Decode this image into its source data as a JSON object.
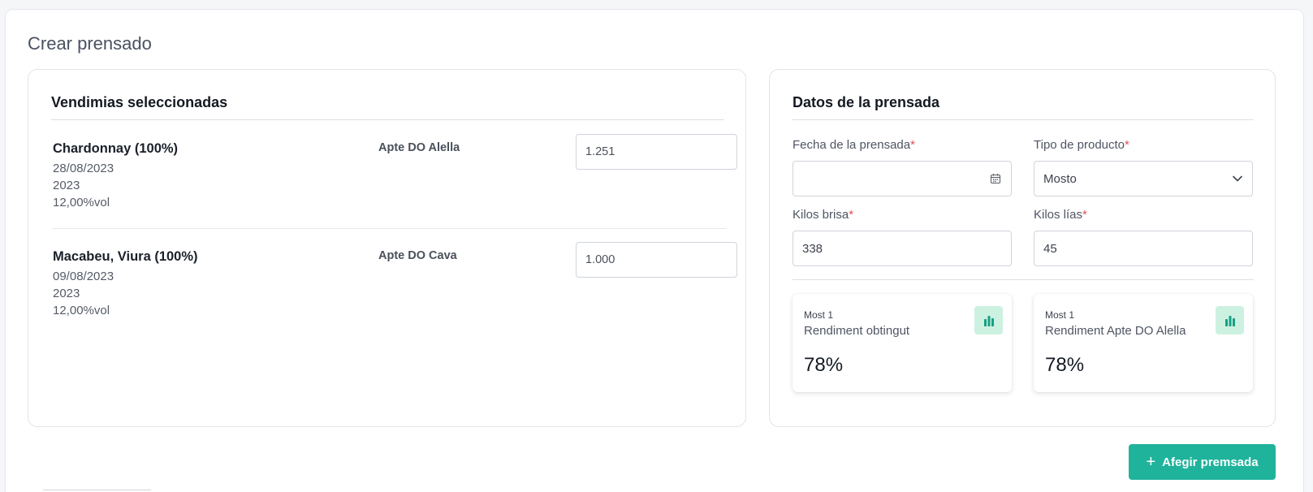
{
  "page": {
    "title": "Crear prensado"
  },
  "harvests": {
    "heading": "Vendimias seleccionadas",
    "rows": [
      {
        "name": "Chardonnay (100%)",
        "date": "28/08/2023",
        "year": "2023",
        "vol": "12,00%vol",
        "do": "Apte DO Alella",
        "kilos": "1.251"
      },
      {
        "name": "Macabeu, Viura (100%)",
        "date": "09/08/2023",
        "year": "2023",
        "vol": "12,00%vol",
        "do": "Apte DO Cava",
        "kilos": "1.000"
      }
    ]
  },
  "pressing": {
    "heading": "Datos de la prensada",
    "fecha": {
      "label": "Fecha de la prensada",
      "required": "*",
      "value": ""
    },
    "tipo": {
      "label": "Tipo de producto",
      "required": "*",
      "value": "Mosto"
    },
    "brisa": {
      "label": "Kilos brisa",
      "required": "*",
      "value": "338"
    },
    "lias": {
      "label": "Kilos lías",
      "required": "*",
      "value": "45"
    },
    "kpis": [
      {
        "tag": "Most 1",
        "label": "Rendiment obtingut",
        "value": "78%",
        "icon": "bar-chart-icon"
      },
      {
        "tag": "Most 1",
        "label": "Rendiment Apte DO Alella",
        "value": "78%",
        "icon": "bar-chart-icon"
      }
    ]
  },
  "actions": {
    "add_label": "Afegir premsada"
  },
  "colors": {
    "accent": "#1fb39c",
    "icon_bg": "#cdf1e0",
    "required": "#e05252"
  }
}
